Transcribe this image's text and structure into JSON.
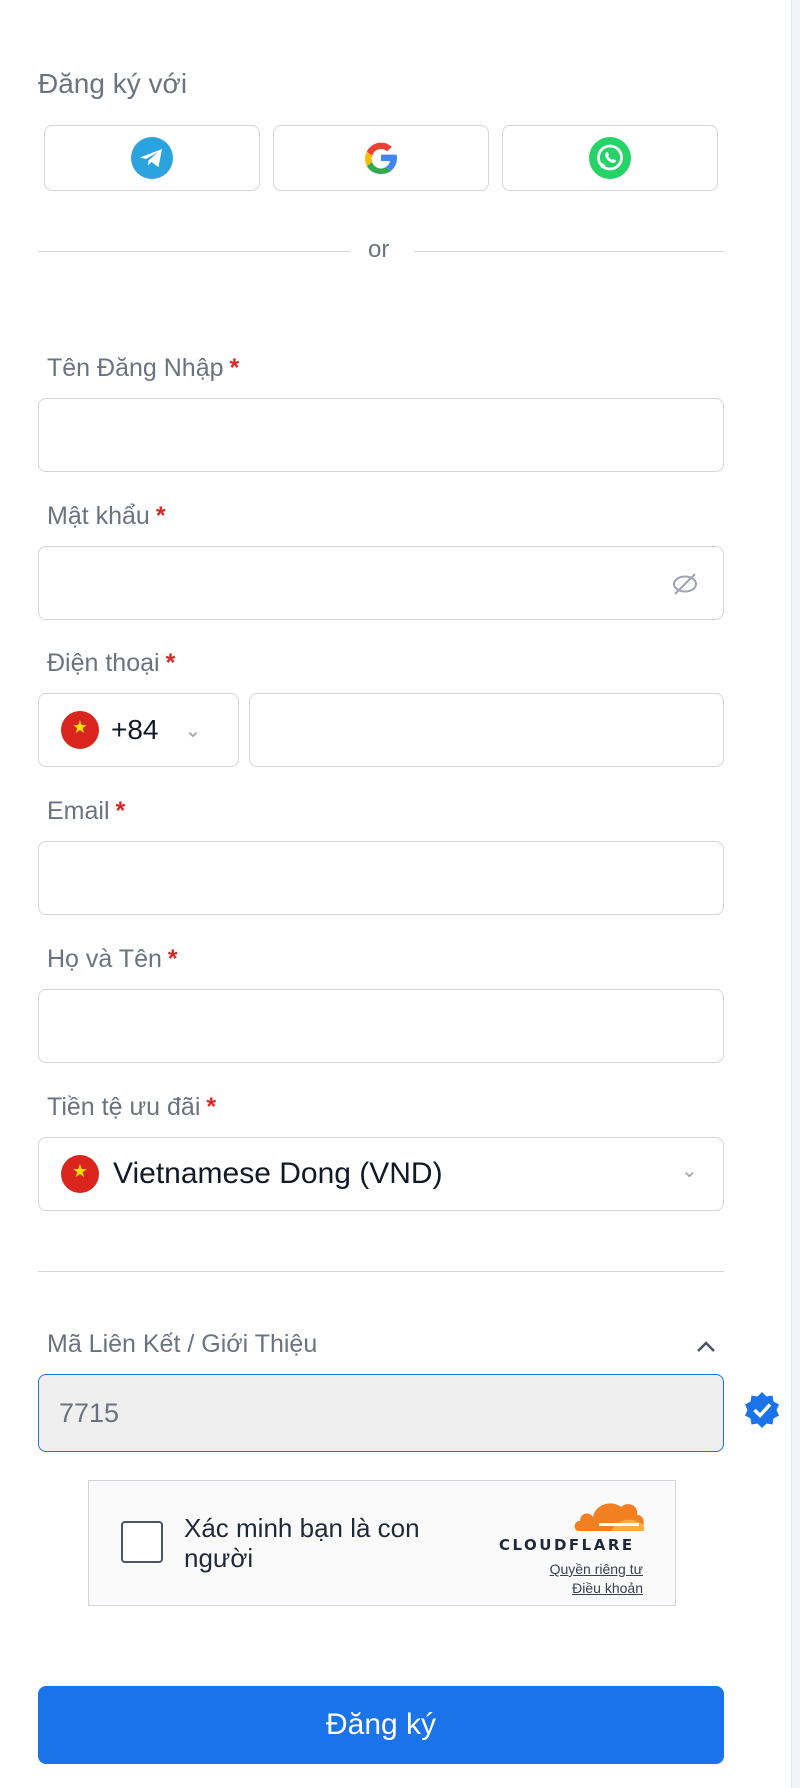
{
  "header": {
    "title": "Đăng ký với"
  },
  "social": {
    "telegram_icon": "telegram-icon",
    "google_icon": "google-icon",
    "whatsapp_icon": "whatsapp-icon"
  },
  "divider": {
    "text": "or"
  },
  "form": {
    "username": {
      "label": "Tên Đăng Nhập",
      "required_mark": "*",
      "value": ""
    },
    "password": {
      "label": "Mật khẩu",
      "required_mark": "*",
      "value": "",
      "toggle_icon": "eye-off-icon"
    },
    "phone": {
      "label": "Điện thoại",
      "required_mark": "*",
      "country_code": "+84",
      "value": ""
    },
    "email": {
      "label": "Email",
      "required_mark": "*",
      "value": ""
    },
    "fullname": {
      "label": "Họ và Tên",
      "required_mark": "*",
      "value": ""
    },
    "currency": {
      "label": "Tiền tệ ưu đãi",
      "required_mark": "*",
      "selected": "Vietnamese Dong (VND)"
    },
    "referral": {
      "label": "Mã Liên Kết / Giới Thiệu",
      "value": "7715",
      "verified_icon": "verified-badge-icon",
      "collapse_icon": "chevron-up-icon"
    }
  },
  "captcha": {
    "label": "Xác minh bạn là con người",
    "brand": "CLOUDFLARE",
    "privacy_link": "Quyền riêng tư",
    "terms_link": "Điều khoản"
  },
  "submit": {
    "label": "Đăng ký"
  },
  "colors": {
    "primary": "#1a73e8",
    "required": "#dc2626",
    "telegram": "#2aa3df",
    "whatsapp": "#25d366",
    "cloudflare": "#f38020"
  }
}
